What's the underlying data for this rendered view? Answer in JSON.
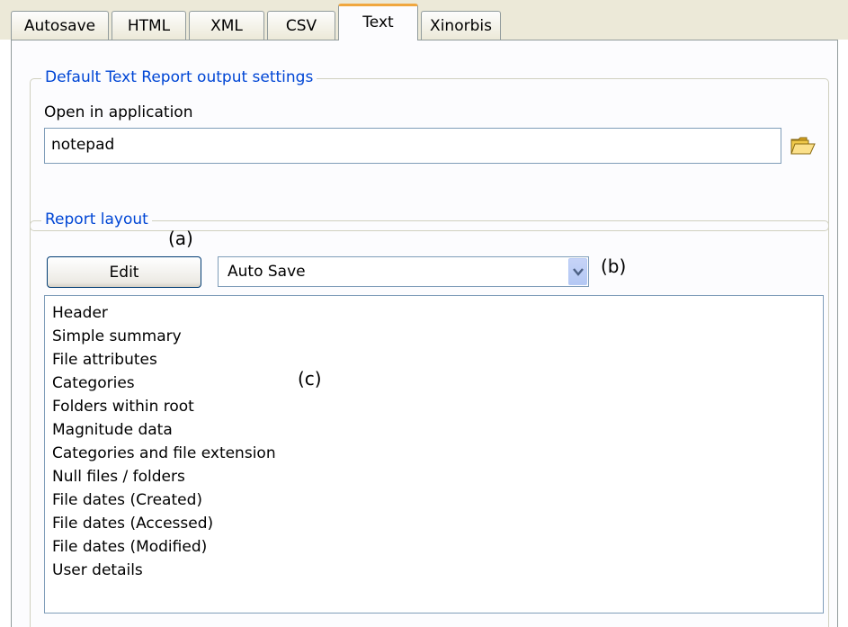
{
  "tabs": [
    {
      "label": "Autosave",
      "active": false
    },
    {
      "label": "HTML",
      "active": false
    },
    {
      "label": "XML",
      "active": false
    },
    {
      "label": "CSV",
      "active": false
    },
    {
      "label": "Text",
      "active": true
    },
    {
      "label": "Xinorbis",
      "active": false
    }
  ],
  "default_settings": {
    "title": "Default Text Report output settings",
    "open_label": "Open in application",
    "application_value": "notepad"
  },
  "report_layout": {
    "title": "Report layout",
    "edit_button_label": "Edit",
    "layout_selected": "Auto Save",
    "items": [
      "Header",
      "Simple summary",
      "File attributes",
      "Categories",
      "Folders within root",
      "Magnitude data",
      "Categories and file extension",
      "Null files / folders",
      "File dates (Created)",
      "File dates (Accessed)",
      "File dates (Modified)",
      "User details"
    ]
  },
  "annotations": {
    "a": "(a)",
    "b": "(b)",
    "c": "(c)"
  },
  "colors": {
    "group_title": "#0046d5",
    "active_tab_accent": "#f0a73f",
    "control_border": "#7f9db9"
  },
  "icons": {
    "browse": "folder-icon",
    "dropdown": "chevron-down-icon"
  }
}
